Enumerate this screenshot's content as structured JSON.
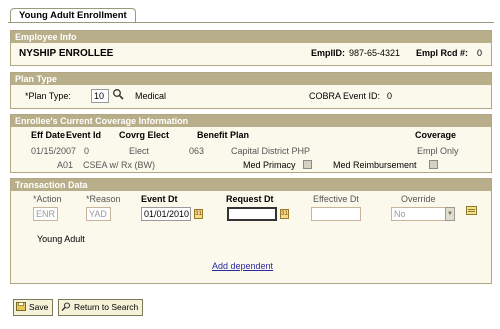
{
  "tab": {
    "label": "Young Adult Enrollment"
  },
  "employee_info": {
    "header": "Employee Info",
    "name": "NYSHIP ENROLLEE",
    "emplid_label": "EmplID:",
    "emplid_value": "987-65-4321",
    "empl_rcd_label": "Empl Rcd #:",
    "empl_rcd_value": "0"
  },
  "plan_type": {
    "header": "Plan Type",
    "label": "*Plan Type:",
    "value": "10",
    "description": "Medical",
    "cobra_label": "COBRA Event ID:",
    "cobra_value": "0"
  },
  "coverage": {
    "header": "Enrollee's Current Coverage Information",
    "col_eff_date": "Eff Date",
    "col_event_id": "Event Id",
    "col_covrg_elect": "Covrg Elect",
    "col_benefit_plan": "Benefit Plan",
    "col_coverage": "Coverage",
    "eff_date": "01/15/2007",
    "event_id": "0",
    "covrg_elect": "Elect",
    "plan_code": "063",
    "plan_name": "Capital District PHP",
    "coverage_value": "Empl Only",
    "option_code": "A01",
    "option_name": "CSEA w/ Rx (BW)",
    "med_primacy_label": "Med Primacy",
    "med_reimb_label": "Med Reimbursement"
  },
  "transaction": {
    "header": "Transaction Data",
    "col_action": "*Action",
    "col_reason": "*Reason",
    "col_event_dt": "Event Dt",
    "col_request_dt": "Request Dt",
    "col_effective_dt": "Effective Dt",
    "col_override": "Override",
    "action_value": "ENR",
    "reason_value": "YAD",
    "event_dt_value": "01/01/2010",
    "request_dt_value": "",
    "effective_dt_value": "",
    "override_value": "No",
    "dependent_name": "Young Adult",
    "add_dependent": "Add dependent"
  },
  "buttons": {
    "save": "Save",
    "return": "Return to Search"
  }
}
